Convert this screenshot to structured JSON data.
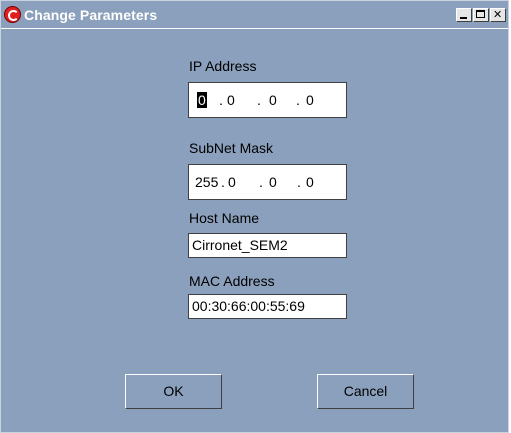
{
  "window": {
    "title": "Change Parameters"
  },
  "fields": {
    "ip_label": "IP Address",
    "ip_octets": [
      "0",
      "0",
      "0",
      "0"
    ],
    "subnet_label": "SubNet Mask",
    "subnet_octets": [
      "255",
      "0",
      "0",
      "0"
    ],
    "host_label": "Host Name",
    "host_value": "Cirronet_SEM2",
    "mac_label": "MAC Address",
    "mac_value": "00:30:66:00:55:69"
  },
  "buttons": {
    "ok_label": "OK",
    "cancel_label": "Cancel"
  },
  "colors": {
    "background": "#8ba0bc",
    "title_text": "#ffffff",
    "app_icon": "#e02020"
  }
}
